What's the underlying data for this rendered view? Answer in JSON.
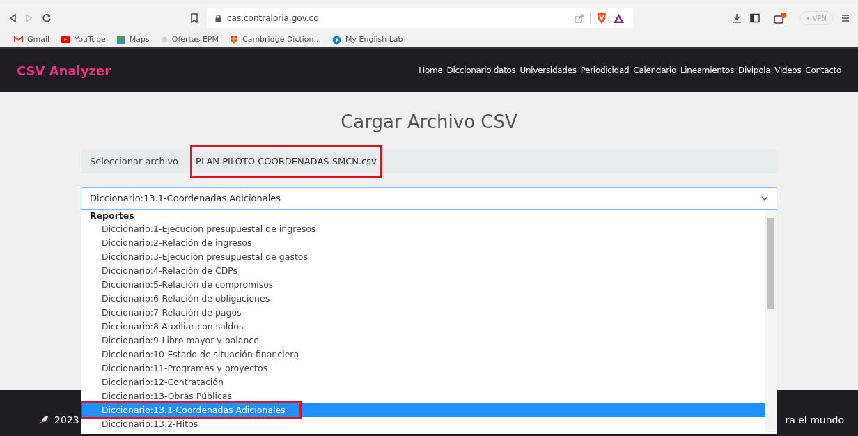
{
  "browser": {
    "url": "cas.contraloria.gov.co",
    "vpn_label": "• VPN",
    "bookmarks": [
      {
        "label": "Gmail",
        "kind": "gmail"
      },
      {
        "label": "YouTube",
        "kind": "youtube"
      },
      {
        "label": "Maps",
        "kind": "maps"
      },
      {
        "label": "Ofertas EPM",
        "kind": "blank"
      },
      {
        "label": "Cambridge Diction...",
        "kind": "shield"
      },
      {
        "label": "My English Lab",
        "kind": "globe"
      }
    ]
  },
  "navbar": {
    "brand": "CSV Analyzer",
    "links": [
      "Home",
      "Diccionario datos",
      "Universidades",
      "Periodicidad",
      "Calendario",
      "Lineamientos",
      "Divipola",
      "Videos",
      "Contacto"
    ]
  },
  "heading": "Cargar Archivo CSV",
  "file_input": {
    "button_label": "Seleccionar archivo",
    "file_name": "PLAN PILOTO COORDENADAS SMCN.csv"
  },
  "select": {
    "value": "Diccionario:13.1-Coordenadas Adicionales",
    "group_label": "Reportes",
    "options": [
      {
        "label": "Diccionario:1-Ejecución presupuestal de ingresos",
        "selected": false
      },
      {
        "label": "Diccionario:2-Relación de ingresos",
        "selected": false
      },
      {
        "label": "Diccionario:3-Ejecución presupuestal de gastos",
        "selected": false
      },
      {
        "label": "Diccionario:4-Relación de CDPs",
        "selected": false
      },
      {
        "label": "Diccionario:5-Relación de compromisos",
        "selected": false
      },
      {
        "label": "Diccionario:6-Relación de obligaciones",
        "selected": false
      },
      {
        "label": "Diccionario:7-Relación de pagos",
        "selected": false
      },
      {
        "label": "Diccionario:8-Auxiliar con saldos",
        "selected": false
      },
      {
        "label": "Diccionario:9-Libro mayor y balance",
        "selected": false
      },
      {
        "label": "Diccionario:10-Estado de situación financiera",
        "selected": false
      },
      {
        "label": "Diccionario:11-Programas y proyectos",
        "selected": false
      },
      {
        "label": "Diccionario:12-Contratación",
        "selected": false
      },
      {
        "label": "Diccionario:13-Obras Públicas",
        "selected": false
      },
      {
        "label": "Diccionario:13.1-Coordenadas Adicionales",
        "selected": true
      },
      {
        "label": "Diccionario:13.2-Hitos",
        "selected": false
      }
    ]
  },
  "footer": {
    "left_text": "2023",
    "right_text": "ra el mundo"
  }
}
